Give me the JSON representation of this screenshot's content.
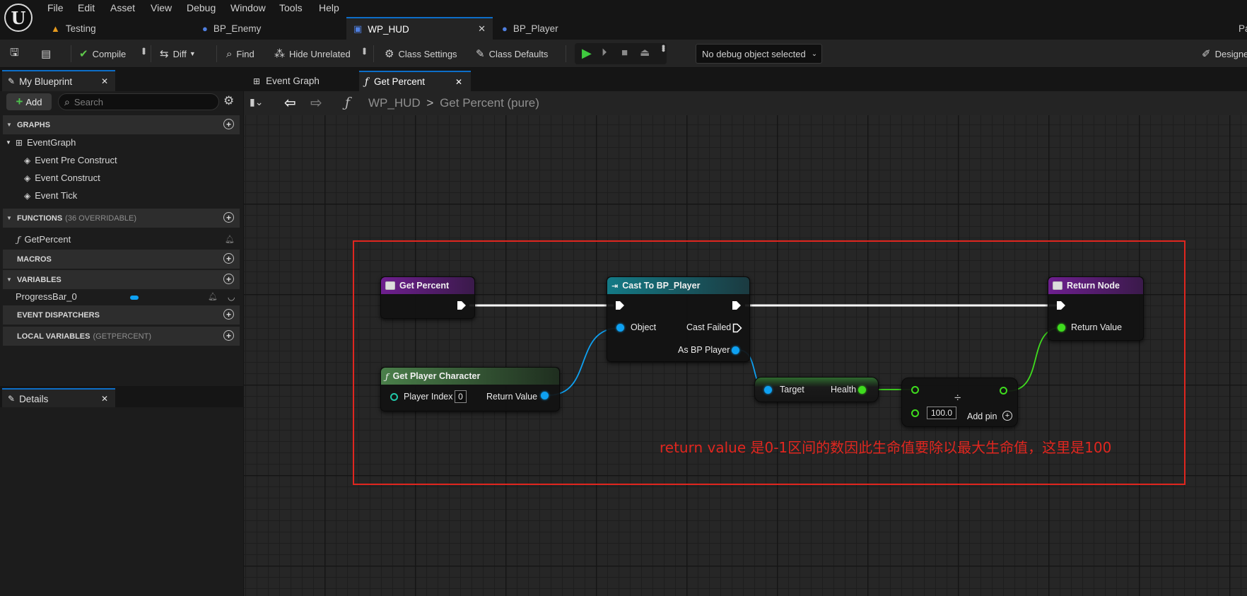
{
  "menu": [
    "File",
    "Edit",
    "Asset",
    "View",
    "Debug",
    "Window",
    "Tools",
    "Help"
  ],
  "tabs": [
    {
      "label": "Testing",
      "icon": "level-icon"
    },
    {
      "label": "BP_Enemy",
      "icon": "blueprint-actor-icon"
    },
    {
      "label": "WP_HUD",
      "icon": "widget-blueprint-icon",
      "active": true
    },
    {
      "label": "BP_Player",
      "icon": "blueprint-actor-icon"
    }
  ],
  "titlebar_right": "Pa",
  "toolbar": {
    "compile": "Compile",
    "diff": "Diff",
    "find": "Find",
    "hide_unrelated": "Hide Unrelated",
    "class_settings": "Class Settings",
    "class_defaults": "Class Defaults",
    "debug_object": "No debug object selected",
    "designer": "Designer"
  },
  "my_blueprint": {
    "tab": "My Blueprint",
    "add": "Add",
    "search_placeholder": "Search",
    "sections": {
      "graphs": "GRAPHS",
      "functions": "FUNCTIONS",
      "functions_sub": "(36 OVERRIDABLE)",
      "macros": "MACROS",
      "variables": "VARIABLES",
      "dispatchers": "EVENT DISPATCHERS",
      "locals": "LOCAL VARIABLES",
      "locals_sub": "(GETPERCENT)"
    },
    "graph_items": [
      "EventGraph",
      "Event Pre Construct",
      "Event Construct",
      "Event Tick"
    ],
    "function_items": [
      "GetPercent"
    ],
    "variable_items": [
      "ProgressBar_0"
    ]
  },
  "details_tab": "Details",
  "graph_tabs": [
    "Event Graph",
    "Get Percent"
  ],
  "breadcrumb": {
    "root": "WP_HUD",
    "separator": ">",
    "current": "Get Percent (pure)"
  },
  "nodes": {
    "get_percent": "Get Percent",
    "cast": {
      "title": "Cast To BP_Player",
      "object": "Object",
      "failed": "Cast Failed",
      "as": "As BP Player"
    },
    "return": {
      "title": "Return Node",
      "value": "Return Value"
    },
    "get_player": {
      "title": "Get Player Character",
      "index_label": "Player Index",
      "index_value": "0",
      "ret": "Return Value"
    },
    "health": {
      "target": "Target",
      "health": "Health"
    },
    "divide": {
      "symbol": "÷",
      "value": "100.0",
      "add_pin": "Add pin"
    }
  },
  "annotation": "return value 是0-1区间的数因此生命值要除以最大生命值，这里是100",
  "colors": {
    "accent": "#0d6ec8",
    "annotation": "#e0261f",
    "exec": "#ffffff",
    "object_pin": "#0ea1f2",
    "float_pin": "#3fdc1e"
  }
}
